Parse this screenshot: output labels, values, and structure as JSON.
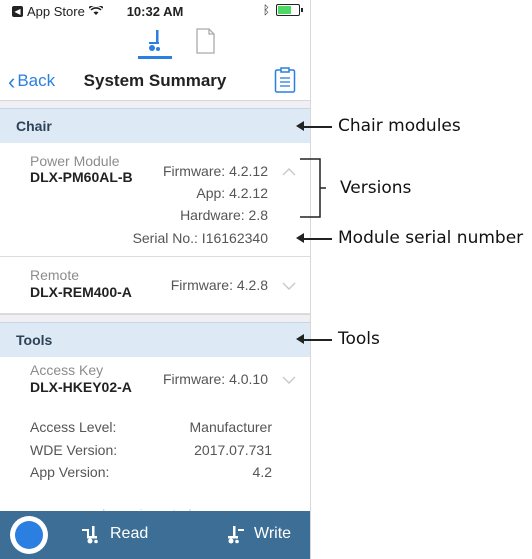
{
  "status_bar": {
    "carrier": "App Store",
    "time": "10:32 AM"
  },
  "nav": {
    "back_label": "Back",
    "title": "System Summary"
  },
  "sections": {
    "chair": {
      "header": "Chair",
      "power_module": {
        "label": "Power Module",
        "name": "DLX-PM60AL-B",
        "firmware": "Firmware: 4.2.12",
        "app": "App: 4.2.12",
        "hardware": "Hardware: 2.8",
        "serial": "Serial No.: I16162340"
      },
      "remote": {
        "label": "Remote",
        "name": "DLX-REM400-A",
        "firmware": "Firmware: 4.2.8"
      }
    },
    "tools": {
      "header": "Tools",
      "access_key": {
        "label": "Access Key",
        "name": "DLX-HKEY02-A",
        "firmware": "Firmware: 4.0.10"
      },
      "details": [
        {
          "key": "Access Level:",
          "value": "Manufacturer"
        },
        {
          "key": "WDE Version:",
          "value": "2017.07.731"
        },
        {
          "key": "App Version:",
          "value": "4.2"
        }
      ]
    }
  },
  "watermark": "www.dynamiccontrols.com",
  "bottom_bar": {
    "read_label": "Read",
    "write_label": "Write"
  },
  "annotations": {
    "chair_modules": "Chair modules",
    "versions": "Versions",
    "module_serial": "Module serial number",
    "tools": "Tools"
  },
  "colors": {
    "accent": "#2a7fe0",
    "section_bg": "#dde9f5",
    "bottom_bar": "#3d6f96"
  }
}
